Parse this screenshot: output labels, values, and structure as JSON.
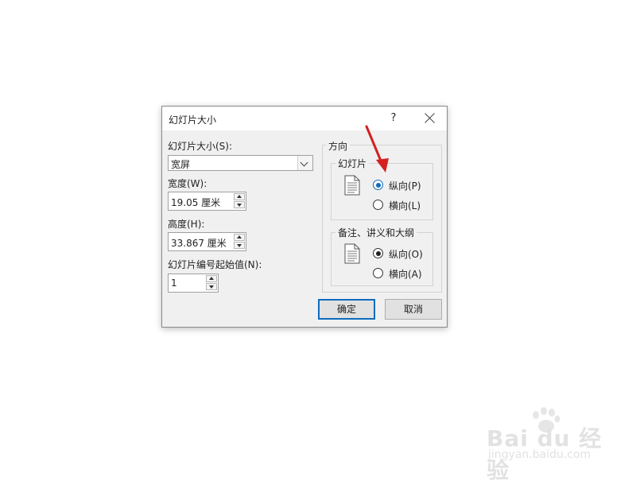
{
  "dialog": {
    "title": "幻灯片大小",
    "help_label": "?"
  },
  "size": {
    "label": "幻灯片大小(S):",
    "selected": "宽屏"
  },
  "width": {
    "label": "宽度(W):",
    "value": "19.05 厘米"
  },
  "height": {
    "label": "高度(H):",
    "value": "33.867 厘米"
  },
  "start_number": {
    "label": "幻灯片编号起始值(N):",
    "value": "1"
  },
  "orientation": {
    "title": "方向",
    "slides": {
      "title": "幻灯片",
      "options": [
        "纵向(P)",
        "横向(L)"
      ],
      "selected": "纵向(P)"
    },
    "notes": {
      "title": "备注、讲义和大纲",
      "options": [
        "纵向(O)",
        "横向(A)"
      ],
      "selected": "纵向(O)"
    }
  },
  "buttons": {
    "ok": "确定",
    "cancel": "取消"
  },
  "colors": {
    "accent": "#0f6cbd",
    "annotation_arrow": "#d42020"
  },
  "watermark": {
    "brand": "Bai du 经验",
    "url": "jingyan.baidu.com"
  }
}
